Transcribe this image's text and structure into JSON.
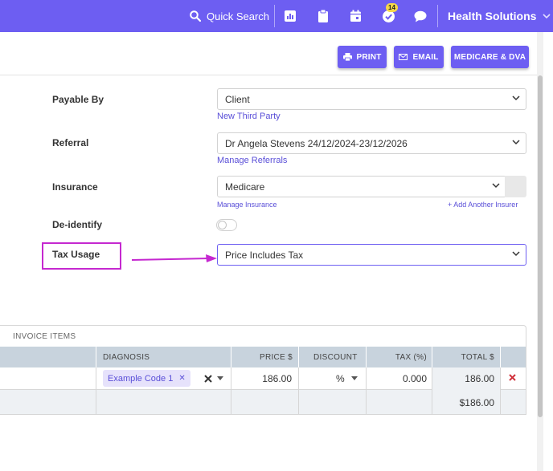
{
  "topbar": {
    "search_label": "Quick Search",
    "tasks_badge": "14",
    "org_name": "Health Solutions",
    "icons": [
      "search-icon",
      "reports-icon",
      "clipboard-icon",
      "calendar-icon",
      "tasks-icon",
      "chat-icon",
      "chevron-down-icon"
    ]
  },
  "toolbar": {
    "print_label": "PRINT",
    "email_label": "EMAIL",
    "medicare_label": "MEDICARE & DVA"
  },
  "form": {
    "payable_by": {
      "label": "Payable By",
      "value": "Client",
      "link": "New Third Party"
    },
    "referral": {
      "label": "Referral",
      "value": "Dr Angela Stevens 24/12/2024-23/12/2026",
      "link": "Manage Referrals"
    },
    "insurance": {
      "label": "Insurance",
      "value": "Medicare",
      "link": "Manage Insurance",
      "link2": "+ Add Another Insurer"
    },
    "deidentify": {
      "label": "De-identify",
      "on": false
    },
    "tax_usage": {
      "label": "Tax Usage",
      "value": "Price Includes Tax"
    }
  },
  "invoice": {
    "title": "INVOICE ITEMS",
    "columns": {
      "diagnosis": "DIAGNOSIS",
      "price": "PRICE $",
      "discount": "DISCOUNT",
      "tax": "TAX (%)",
      "total": "TOTAL $"
    },
    "row": {
      "diagnosis_chip": "Example Code 1",
      "price": "186.00",
      "discount_unit": "%",
      "tax": "0.000",
      "total": "186.00"
    },
    "grand_total": "$186.00"
  },
  "colors": {
    "accent": "#6d5ef2",
    "annotation": "#c528d0",
    "header_bg": "#c8d3dd",
    "delete": "#d0303a"
  }
}
